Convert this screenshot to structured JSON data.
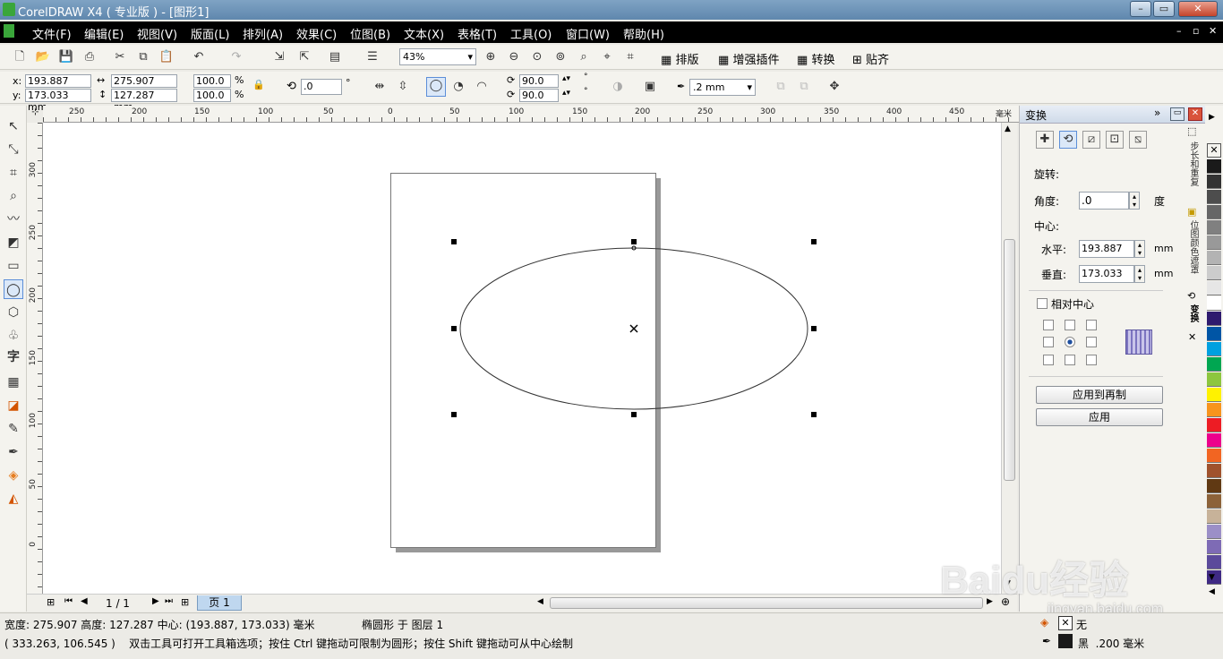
{
  "app": {
    "title": "CorelDRAW X4 ( 专业版 ) - [图形1]"
  },
  "menu": {
    "items": [
      "文件(F)",
      "编辑(E)",
      "视图(V)",
      "版面(L)",
      "排列(A)",
      "效果(C)",
      "位图(B)",
      "文本(X)",
      "表格(T)",
      "工具(O)",
      "窗口(W)",
      "帮助(H)"
    ]
  },
  "toolbar": {
    "zoom": "43%",
    "plugins": [
      {
        "label": "排版"
      },
      {
        "label": "增强插件"
      },
      {
        "label": "转换"
      },
      {
        "label": "贴齐"
      }
    ]
  },
  "propbar": {
    "x_label": "x:",
    "x": "193.887 mm",
    "y_label": "y:",
    "y": "173.033 mm",
    "width": "275.907 mm",
    "height": "127.287 mm",
    "scale_w": "100.0",
    "scale_h": "100.0",
    "pct": "%",
    "angle": ".0",
    "deg": "°",
    "start_angle": "90.0",
    "end_angle": "90.0",
    "outline_width": ".2 mm"
  },
  "rulers": {
    "h": [
      "250",
      "200",
      "150",
      "100",
      "50",
      "0",
      "50",
      "100",
      "150",
      "200",
      "250",
      "300",
      "350",
      "400",
      "450"
    ],
    "h_unit": "毫米",
    "v": [
      "300",
      "250",
      "200",
      "150",
      "100",
      "50",
      "0"
    ]
  },
  "pagenav": {
    "counter": "1 / 1",
    "page_tab": "页 1"
  },
  "docker": {
    "title": "变换",
    "section": "旋转:",
    "angle_label": "角度:",
    "angle_value": ".0",
    "angle_unit": "度",
    "center_label": "中心:",
    "h_label": "水平:",
    "h_value": "193.887",
    "v_label": "垂直:",
    "v_value": "173.033",
    "unit": "mm",
    "relative_center": "相对中心",
    "apply_copy": "应用到再制",
    "apply": "应用",
    "tabs": [
      "步长和重复",
      "位图颜色遮罩",
      "变换"
    ]
  },
  "status": {
    "line1": "宽度: 275.907 高度: 127.287 中心: (193.887, 173.033) 毫米",
    "object": "椭圆形 于 图层 1",
    "line2": "( 333.263, 106.545 )    双击工具可打开工具箱选项；按住 Ctrl 键拖动可限制为圆形；按住 Shift 键拖动可从中心绘制",
    "fill_label": "无",
    "outline_label": "黑  .200 毫米"
  },
  "watermark": {
    "logo": "Baidu经验",
    "url": "jingyan.baidu.com"
  },
  "colors": {
    "palette": [
      "#ffffff",
      "#000000",
      "#1a1a1a",
      "#333333",
      "#4d4d4d",
      "#666666",
      "#808080",
      "#999999",
      "#b3b3b3",
      "#cccccc",
      "#e6e6e6",
      "#ffffff",
      "#2e1a6e",
      "#0055a5",
      "#00a0e0",
      "#00a651",
      "#8dc63f",
      "#fff200",
      "#f7941d",
      "#ed1c24",
      "#ec008c",
      "#f26522",
      "#a0522d",
      "#603913",
      "#8c6239",
      "#c7b299",
      "#9b8fc7",
      "#7e6bb5",
      "#5b4a9b",
      "#3f2a84"
    ]
  }
}
